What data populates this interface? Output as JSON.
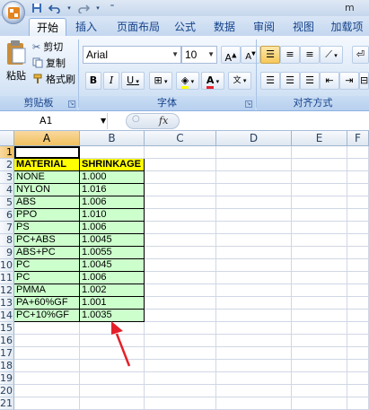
{
  "titlebar": {
    "title": "m",
    "qat_icons": [
      "save-icon",
      "undo-icon",
      "redo-icon",
      "customize-icon"
    ]
  },
  "tabs": [
    {
      "label": "开始",
      "active": true
    },
    {
      "label": "插入",
      "active": false
    },
    {
      "label": "页面布局",
      "active": false
    },
    {
      "label": "公式",
      "active": false
    },
    {
      "label": "数据",
      "active": false
    },
    {
      "label": "审阅",
      "active": false
    },
    {
      "label": "视图",
      "active": false
    },
    {
      "label": "加载项",
      "active": false
    }
  ],
  "clipboard": {
    "paste_label": "粘贴",
    "cut_label": "剪切",
    "copy_label": "复制",
    "format_painter_label": "格式刷",
    "group_label": "剪贴板"
  },
  "font": {
    "name": "Arial",
    "size": "10",
    "group_label": "字体",
    "phonetic_label": "文"
  },
  "alignment": {
    "group_label": "对齐方式"
  },
  "formula_bar": {
    "cell_ref": "A1",
    "fx_label": "fx",
    "content": ""
  },
  "sheet": {
    "columns": [
      "A",
      "B",
      "C",
      "D",
      "E",
      "F"
    ],
    "rows": [
      "1",
      "2",
      "3",
      "4",
      "5",
      "6",
      "7",
      "8",
      "9",
      "10",
      "11",
      "12",
      "13",
      "14",
      "15",
      "16",
      "17",
      "18",
      "19",
      "20",
      "21"
    ],
    "header": {
      "material": "MATERIAL",
      "shrinkage": "SHRINKAGE"
    },
    "data": [
      {
        "material": "NONE",
        "shrinkage": "1.000"
      },
      {
        "material": "NYLON",
        "shrinkage": "1.016"
      },
      {
        "material": "ABS",
        "shrinkage": "1.006"
      },
      {
        "material": "PPO",
        "shrinkage": "1.010"
      },
      {
        "material": "PS",
        "shrinkage": "1.006"
      },
      {
        "material": "PC+ABS",
        "shrinkage": "1.0045"
      },
      {
        "material": "ABS+PC",
        "shrinkage": "1.0055"
      },
      {
        "material": "PC",
        "shrinkage": "1.0045"
      },
      {
        "material": "PC",
        "shrinkage": "1.006"
      },
      {
        "material": "PMMA",
        "shrinkage": "1.002"
      },
      {
        "material": "PA+60%GF",
        "shrinkage": "1.001"
      },
      {
        "material": "PC+10%GF",
        "shrinkage": "1.0035"
      }
    ]
  },
  "colors": {
    "accent": "#e3851f",
    "header_fill": "#ffff00",
    "data_fill": "#ccffcc",
    "arrow": "#e5202a"
  }
}
